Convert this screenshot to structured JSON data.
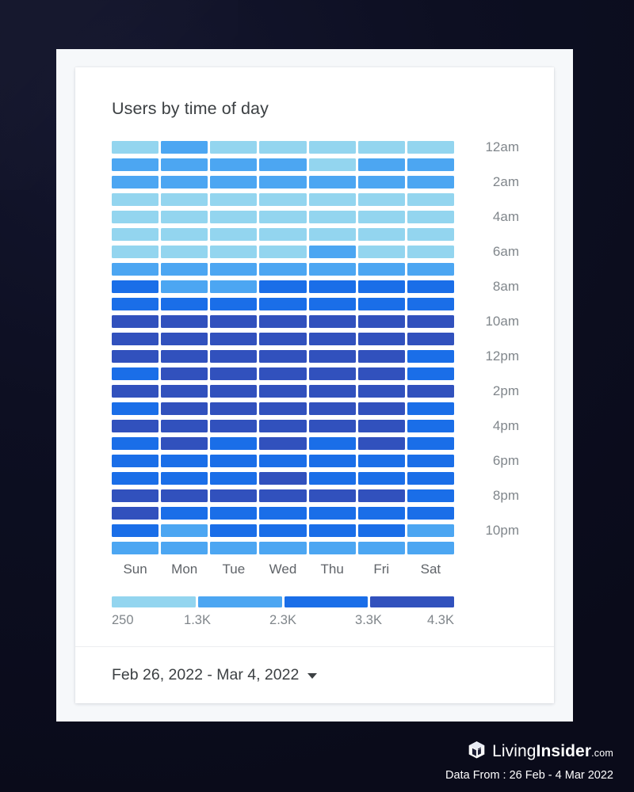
{
  "card": {
    "title": "Users by time of day",
    "footer": {
      "date_range": "Feb 26, 2022 - Mar 4, 2022",
      "dropdown_icon": "chevron-down-icon"
    }
  },
  "watermark": {
    "logo_icon": "house-logo-icon",
    "brand_part1": "Living",
    "brand_part2": "Insider",
    "brand_tld": ".com",
    "data_from": "Data From : 26 Feb - 4 Mar 2022"
  },
  "palette": {
    "background_dark": "#0c0d21",
    "panel": "#f6f8fa",
    "card": "#ffffff",
    "level1": "#93d5ef",
    "level2": "#4ca6f2",
    "level3": "#1a6ee8",
    "level4": "#3151bd",
    "title_text": "#3c4043",
    "axis_text": "#80868b",
    "day_text": "#5f6368"
  },
  "chart_data": {
    "type": "heatmap",
    "title": "Users by time of day",
    "xlabel": "",
    "ylabel": "",
    "x_categories": [
      "Sun",
      "Mon",
      "Tue",
      "Wed",
      "Thu",
      "Fri",
      "Sat"
    ],
    "y_categories": [
      "12am",
      "1am",
      "2am",
      "3am",
      "4am",
      "5am",
      "6am",
      "7am",
      "8am",
      "9am",
      "10am",
      "11am",
      "12pm",
      "1pm",
      "2pm",
      "3pm",
      "4pm",
      "5pm",
      "6pm",
      "7pm",
      "8pm",
      "9pm",
      "10pm",
      "11pm"
    ],
    "y_tick_labels": [
      "12am",
      "2am",
      "4am",
      "6am",
      "8am",
      "10am",
      "12pm",
      "2pm",
      "4pm",
      "6pm",
      "8pm",
      "10pm"
    ],
    "y_tick_rows": [
      0,
      2,
      4,
      6,
      8,
      10,
      12,
      14,
      16,
      18,
      20,
      22
    ],
    "legend": {
      "position": "bottom",
      "tick_labels": [
        "250",
        "1.3K",
        "2.3K",
        "3.3K",
        "4.3K"
      ],
      "band_colors": [
        "#93d5ef",
        "#4ca6f2",
        "#1a6ee8",
        "#3151bd"
      ],
      "band_ranges": [
        [
          250,
          1300
        ],
        [
          1300,
          2300
        ],
        [
          2300,
          3300
        ],
        [
          3300,
          4300
        ]
      ]
    },
    "level_colors": [
      "#93d5ef",
      "#4ca6f2",
      "#1a6ee8",
      "#3151bd"
    ],
    "level_value_midpoints": [
      775,
      1800,
      2800,
      3800
    ],
    "grid": false,
    "rows": [
      {
        "hour": "12am",
        "levels": [
          1,
          2,
          1,
          1,
          1,
          1,
          1
        ]
      },
      {
        "hour": "1am",
        "levels": [
          2,
          2,
          2,
          2,
          1,
          2,
          2
        ]
      },
      {
        "hour": "2am",
        "levels": [
          2,
          2,
          2,
          2,
          2,
          2,
          2
        ]
      },
      {
        "hour": "3am",
        "levels": [
          1,
          1,
          1,
          1,
          1,
          1,
          1
        ]
      },
      {
        "hour": "4am",
        "levels": [
          1,
          1,
          1,
          1,
          1,
          1,
          1
        ]
      },
      {
        "hour": "5am",
        "levels": [
          1,
          1,
          1,
          1,
          1,
          1,
          1
        ]
      },
      {
        "hour": "6am",
        "levels": [
          1,
          1,
          1,
          1,
          2,
          1,
          1
        ]
      },
      {
        "hour": "7am",
        "levels": [
          2,
          2,
          2,
          2,
          2,
          2,
          2
        ]
      },
      {
        "hour": "8am",
        "levels": [
          3,
          2,
          2,
          3,
          3,
          3,
          3
        ]
      },
      {
        "hour": "9am",
        "levels": [
          3,
          3,
          3,
          3,
          3,
          3,
          3
        ]
      },
      {
        "hour": "10am",
        "levels": [
          4,
          4,
          4,
          4,
          4,
          4,
          4
        ]
      },
      {
        "hour": "11am",
        "levels": [
          4,
          4,
          4,
          4,
          4,
          4,
          4
        ]
      },
      {
        "hour": "12pm",
        "levels": [
          4,
          4,
          4,
          4,
          4,
          4,
          3
        ]
      },
      {
        "hour": "1pm",
        "levels": [
          3,
          4,
          4,
          4,
          4,
          4,
          3
        ]
      },
      {
        "hour": "2pm",
        "levels": [
          4,
          4,
          4,
          4,
          4,
          4,
          4
        ]
      },
      {
        "hour": "3pm",
        "levels": [
          3,
          4,
          4,
          4,
          4,
          4,
          3
        ]
      },
      {
        "hour": "4pm",
        "levels": [
          4,
          4,
          4,
          4,
          4,
          4,
          3
        ]
      },
      {
        "hour": "5pm",
        "levels": [
          3,
          4,
          3,
          4,
          3,
          4,
          3
        ]
      },
      {
        "hour": "6pm",
        "levels": [
          3,
          3,
          3,
          3,
          3,
          3,
          3
        ]
      },
      {
        "hour": "7pm",
        "levels": [
          3,
          3,
          3,
          4,
          3,
          3,
          3
        ]
      },
      {
        "hour": "8pm",
        "levels": [
          4,
          4,
          4,
          4,
          4,
          4,
          3
        ]
      },
      {
        "hour": "9pm",
        "levels": [
          4,
          3,
          3,
          3,
          3,
          3,
          3
        ]
      },
      {
        "hour": "10pm",
        "levels": [
          3,
          2,
          3,
          3,
          3,
          3,
          2
        ]
      },
      {
        "hour": "11pm",
        "levels": [
          2,
          2,
          2,
          2,
          2,
          2,
          2
        ]
      }
    ]
  }
}
